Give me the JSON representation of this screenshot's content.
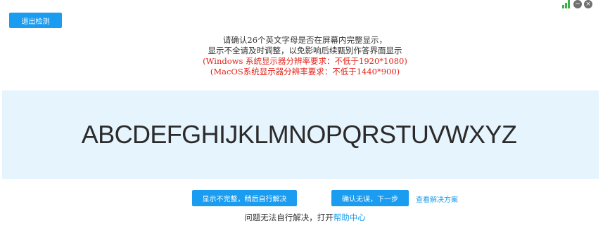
{
  "header": {
    "exit_button": "退出检测"
  },
  "instructions": {
    "line1": "请确认26个英文字母是否在屏幕内完整显示，",
    "line2": "显示不全请及时调整，以免影响后续甄别作答界面显示",
    "windows_req": "(Windows 系统显示器分辨率要求：不低于1920*1080)",
    "mac_req": "(MacOS系统显示器分辨率要求：不低于1440*900)"
  },
  "alphabet": "ABCDEFGHIJKLMNOPQRSTUVWXYZ",
  "actions": {
    "incomplete_button": "显示不完整，稍后自行解决",
    "confirm_button": "确认无误，下一步",
    "solution_link": "查看解决方案"
  },
  "help": {
    "prefix": "问题无法自行解决，打开",
    "link": "帮助中心"
  },
  "status": {
    "icons": [
      "signal-icon",
      "minimize-icon",
      "close-icon"
    ],
    "accent_color": "#1a9cf0",
    "warning_color": "#e2231a",
    "signal_color": "#3db14a"
  }
}
